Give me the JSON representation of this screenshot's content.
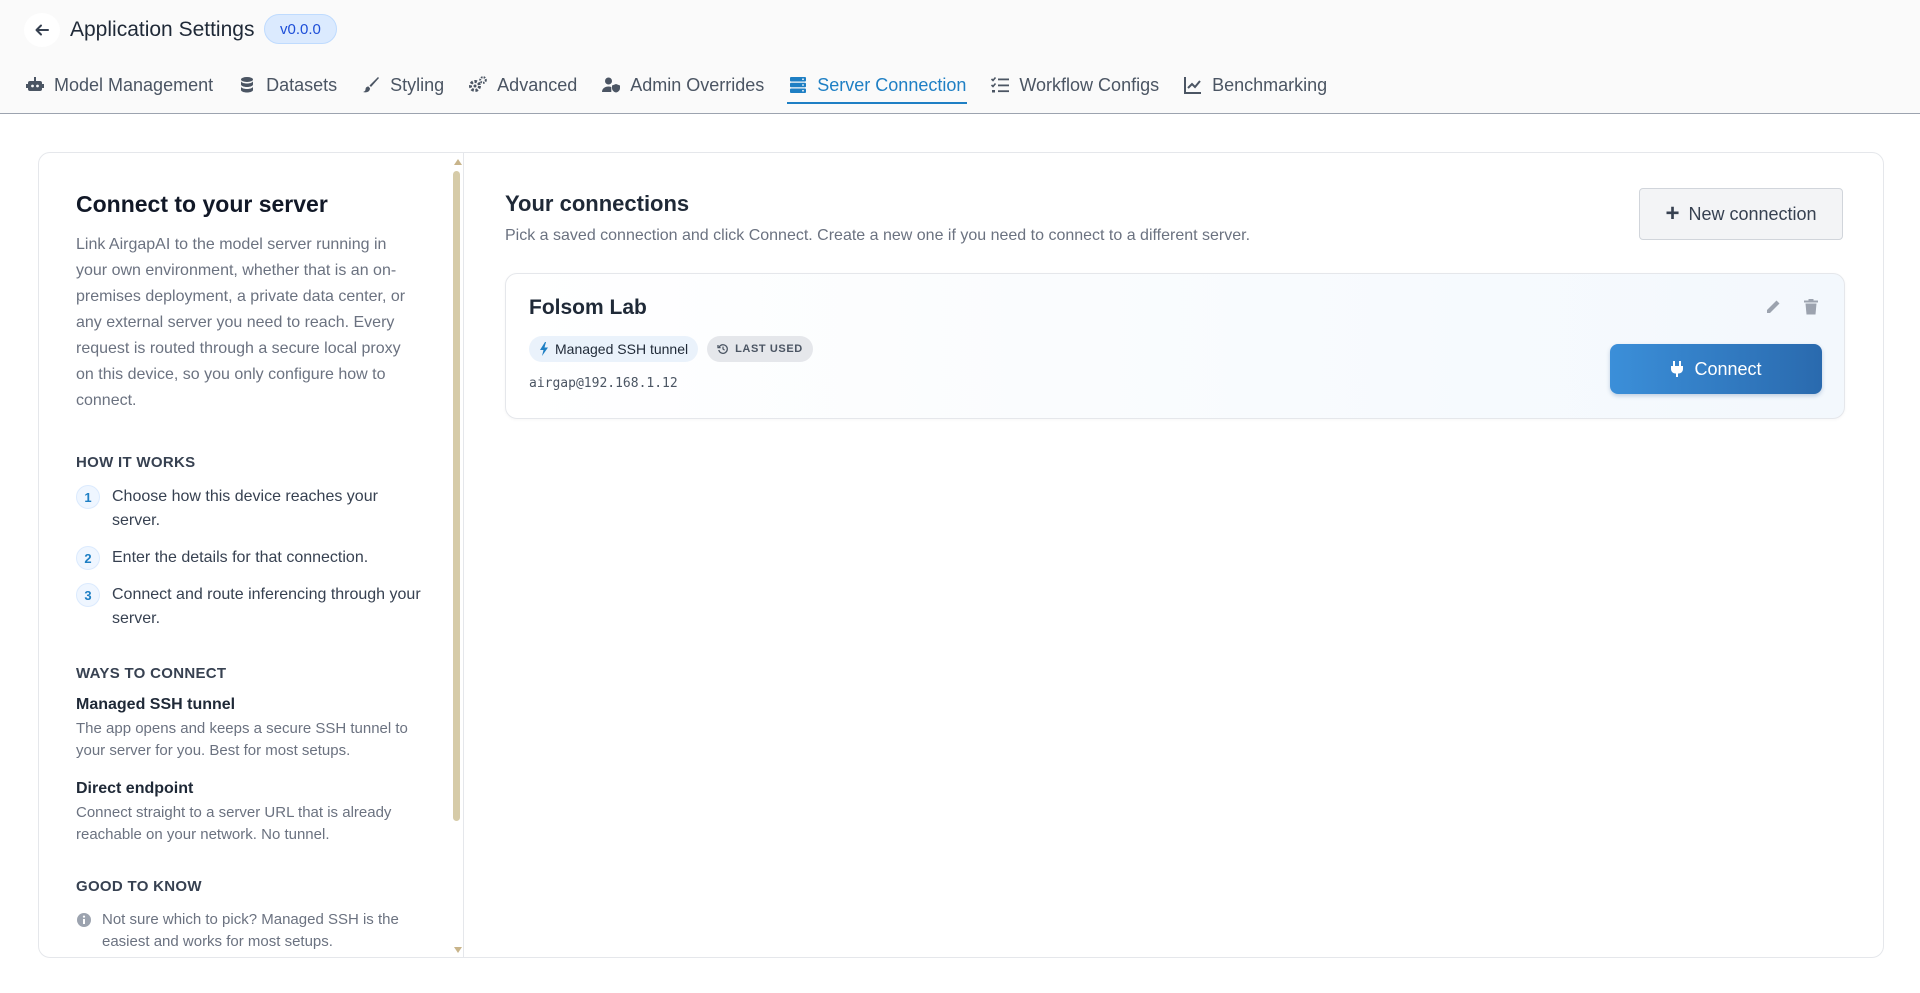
{
  "header": {
    "title": "Application Settings",
    "version": "v0.0.0",
    "back_icon": "arrow-left-icon"
  },
  "tabs": [
    {
      "label": "Model Management",
      "icon": "robot-icon",
      "active": false
    },
    {
      "label": "Datasets",
      "icon": "database-icon",
      "active": false
    },
    {
      "label": "Styling",
      "icon": "brush-icon",
      "active": false
    },
    {
      "label": "Advanced",
      "icon": "gears-icon",
      "active": false
    },
    {
      "label": "Admin Overrides",
      "icon": "user-shield-icon",
      "active": false
    },
    {
      "label": "Server Connection",
      "icon": "server-icon",
      "active": true
    },
    {
      "label": "Workflow Configs",
      "icon": "list-check-icon",
      "active": false
    },
    {
      "label": "Benchmarking",
      "icon": "chart-line-icon",
      "active": false
    }
  ],
  "guide": {
    "title": "Connect to your server",
    "intro": "Link AirgapAI to the model server running in your own environment, whether that is an on-premises deployment, a private data center, or any external server you need to reach. Every request is routed through a secure local proxy on this device, so you only configure how to connect.",
    "how_it_works": {
      "heading": "HOW IT WORKS",
      "steps": [
        {
          "num": "1",
          "text": "Choose how this device reaches your server."
        },
        {
          "num": "2",
          "text": "Enter the details for that connection."
        },
        {
          "num": "3",
          "text": "Connect and route inferencing through your server."
        }
      ]
    },
    "ways": {
      "heading": "WAYS TO CONNECT",
      "items": [
        {
          "title": "Managed SSH tunnel",
          "desc": "The app opens and keeps a secure SSH tunnel to your server for you. Best for most setups."
        },
        {
          "title": "Direct endpoint",
          "desc": "Connect straight to a server URL that is already reachable on your network. No tunnel."
        }
      ]
    },
    "good_to_know": {
      "heading": "GOOD TO KNOW",
      "tip": "Not sure which to pick? Managed SSH is the easiest and works for most setups."
    }
  },
  "connections": {
    "title": "Your connections",
    "subtitle": "Pick a saved connection and click Connect. Create a new one if you need to connect to a different server.",
    "new_button": "New connection",
    "items": [
      {
        "name": "Folsom Lab",
        "type_chip": "Managed SSH tunnel",
        "status_chip": "LAST USED",
        "host": "airgap@192.168.1.12",
        "connect_label": "Connect"
      }
    ]
  },
  "colors": {
    "accent": "#1e7fc4",
    "connect_start": "#3b8fd9",
    "connect_end": "#2a6aae",
    "scrollbar": "#d6cba8"
  }
}
